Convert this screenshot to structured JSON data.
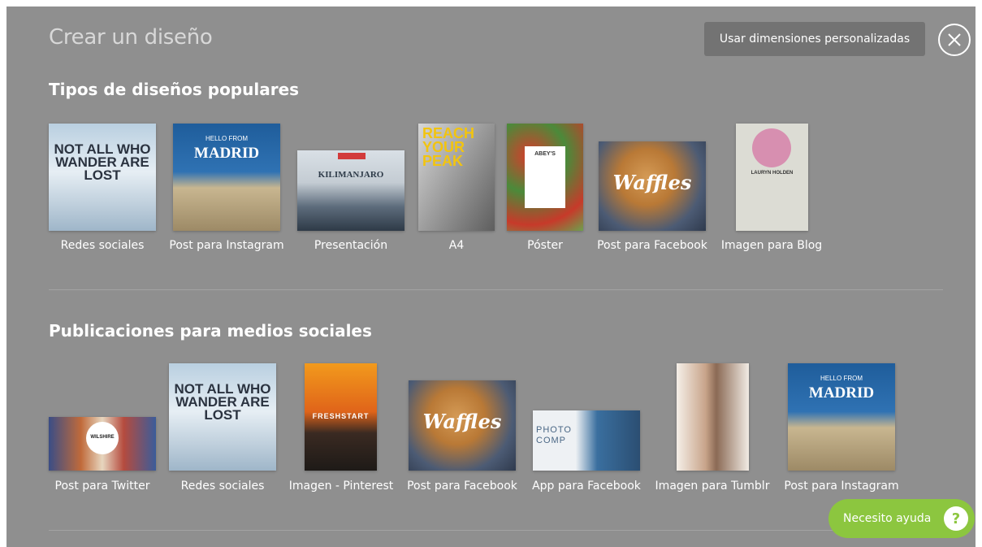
{
  "header": {
    "title": "Crear un diseño",
    "custom_dimensions_label": "Usar dimensiones personalizadas"
  },
  "popular": {
    "title": "Tipos de diseños populares",
    "items": [
      {
        "label": "Redes sociales",
        "thumb_text": "NOT ALL WHO WANDER ARE LOST"
      },
      {
        "label": "Post para Instagram",
        "thumb_text": "MADRID",
        "thumb_sub": "HELLO FROM"
      },
      {
        "label": "Presentación",
        "thumb_text": "KILIMANJARO"
      },
      {
        "label": "A4",
        "thumb_text": "REACH YOUR PEAK"
      },
      {
        "label": "Póster",
        "thumb_text": "ABEY'S"
      },
      {
        "label": "Post para Facebook",
        "thumb_text": "Waffles"
      },
      {
        "label": "Imagen para Blog",
        "thumb_text": "LAURYN HOLDEN"
      }
    ]
  },
  "social": {
    "title": "Publicaciones para medios sociales",
    "items": [
      {
        "label": "Post para Twitter",
        "thumb_text": "WILSHIRE"
      },
      {
        "label": "Redes sociales",
        "thumb_text": "NOT ALL WHO WANDER ARE LOST"
      },
      {
        "label": "Imagen - Pinterest",
        "thumb_text": "FRESHSTART"
      },
      {
        "label": "Post para Facebook",
        "thumb_text": "Waffles"
      },
      {
        "label": "App para Facebook",
        "thumb_text": "PHOTO COMP"
      },
      {
        "label": "Imagen para Tumblr",
        "thumb_text": ""
      },
      {
        "label": "Post para Instagram",
        "thumb_text": "MADRID",
        "thumb_sub": "HELLO FROM"
      }
    ]
  },
  "help": {
    "label": "Necesito ayuda",
    "icon": "?"
  },
  "colors": {
    "overlay": "#8f8f8f",
    "help_green": "#8cc63f",
    "button_dark": "#737373"
  }
}
